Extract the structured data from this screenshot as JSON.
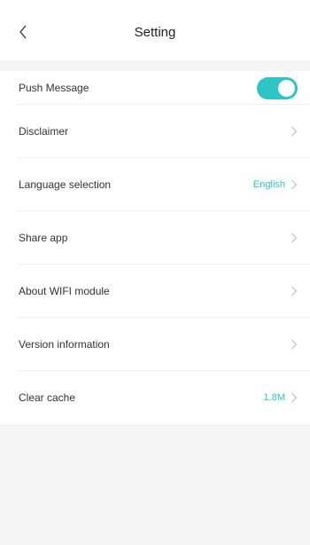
{
  "header": {
    "title": "Setting",
    "back_icon": "chevron-left-icon"
  },
  "settings": {
    "push_message": {
      "label": "Push Message",
      "toggle_on": true
    },
    "disclaimer": {
      "label": "Disclaimer"
    },
    "language": {
      "label": "Language selection",
      "value": "English"
    },
    "share": {
      "label": "Share app"
    },
    "wifi": {
      "label": "About WIFI module"
    },
    "version": {
      "label": "Version information"
    },
    "cache": {
      "label": "Clear cache",
      "value": "1.8M"
    }
  },
  "colors": {
    "accent": "#2cc6c4",
    "background": "#f5f5f5",
    "text": "#333333"
  }
}
